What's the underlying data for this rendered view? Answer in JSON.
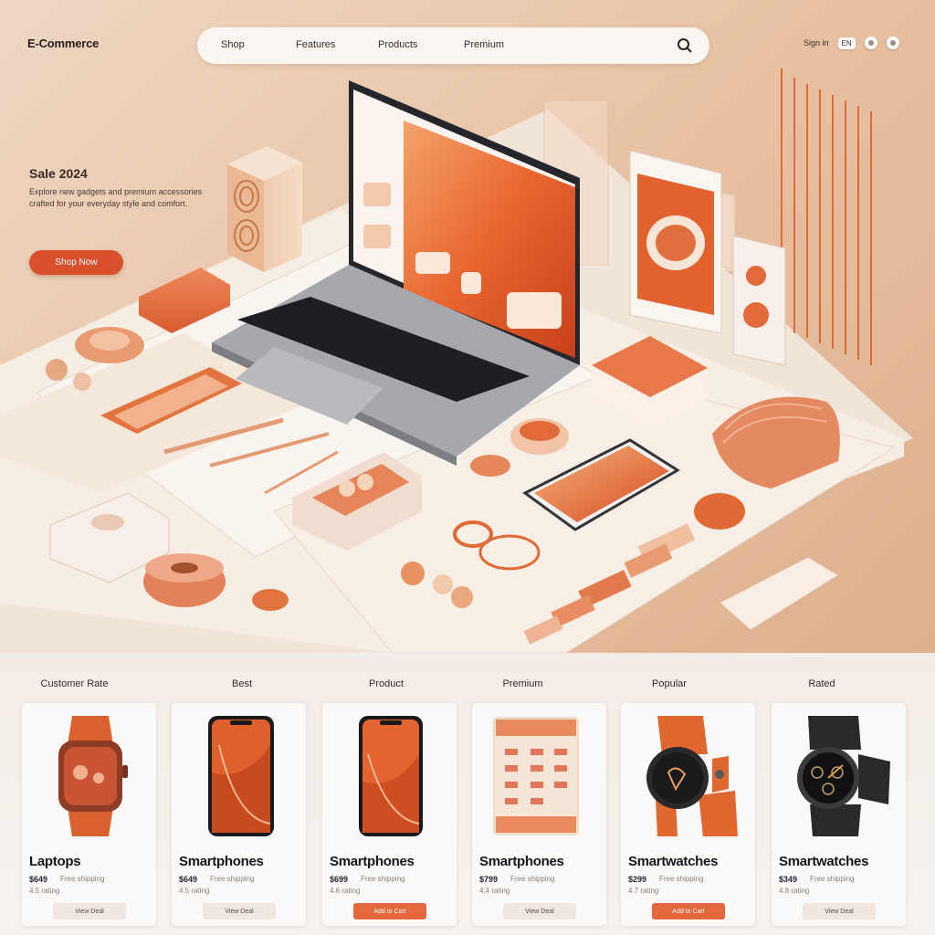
{
  "header": {
    "logo": "E-Commerce",
    "nav": [
      "Shop",
      "Features",
      "Products",
      "Premium"
    ],
    "util_text": "Sign in",
    "util_badge": "EN",
    "search_icon": "search-icon",
    "icons": [
      "globe-icon",
      "user-icon"
    ]
  },
  "hero": {
    "title": "Sale 2024",
    "description": "Explore new gadgets and premium accessories crafted for your everyday style and comfort.",
    "cta": "Shop Now"
  },
  "colors": {
    "accent": "#d8512c",
    "accent_light": "#e5673c",
    "background": "#efe2d6",
    "card": "#fbf9f7"
  },
  "categories": [
    "Customer Rate",
    "Best",
    "Product",
    "Premium",
    "Popular",
    "Rated"
  ],
  "products": [
    {
      "name": "Laptops",
      "price": "$649",
      "meta": "Free shipping",
      "sub": "4.5 rating",
      "button": "View Deal",
      "image": "smartwatch-orange",
      "accent": false
    },
    {
      "name": "Smartphones",
      "price": "$649",
      "meta": "Free shipping",
      "sub": "4.5 rating",
      "button": "View Deal",
      "image": "smartphone-orange",
      "accent": false
    },
    {
      "name": "Smartphones",
      "price": "$699",
      "meta": "Free shipping",
      "sub": "4.6 rating",
      "button": "Add to Cart",
      "image": "smartphone-orange",
      "accent": true
    },
    {
      "name": "Smartphones",
      "price": "$799",
      "meta": "Free shipping",
      "sub": "4.4 rating",
      "button": "View Deal",
      "image": "product-box",
      "accent": false
    },
    {
      "name": "Smartwatches",
      "price": "$299",
      "meta": "Free shipping",
      "sub": "4.7 rating",
      "button": "Add to Cart",
      "image": "smartwatch-sport",
      "accent": true
    },
    {
      "name": "Smartwatches",
      "price": "$349",
      "meta": "Free shipping",
      "sub": "4.8 rating",
      "button": "View Deal",
      "image": "smartwatch-black",
      "accent": false
    }
  ]
}
